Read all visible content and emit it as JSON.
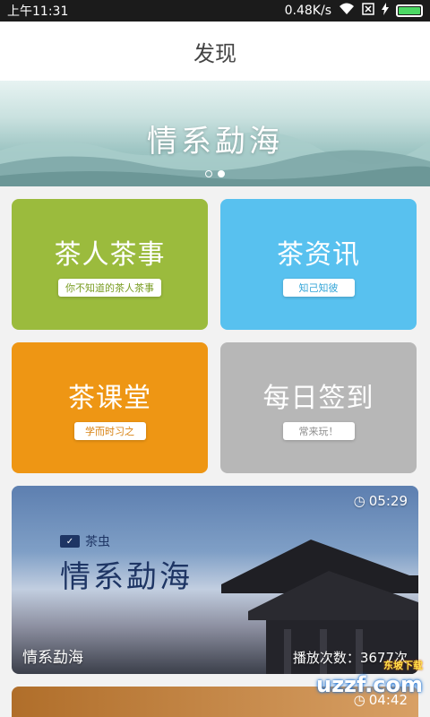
{
  "status": {
    "time": "上午11:31",
    "speed": "0.48K/s"
  },
  "appbar": {
    "title": "发现"
  },
  "banner": {
    "title": "情系勐海"
  },
  "tiles": [
    {
      "title": "茶人茶事",
      "tag": "你不知道的茶人茶事"
    },
    {
      "title": "茶资讯",
      "tag": "知己知彼"
    },
    {
      "title": "茶课堂",
      "tag": "学而时习之"
    },
    {
      "title": "每日签到",
      "tag": "常来玩！"
    }
  ],
  "video": {
    "brand": "茶虫",
    "title": "情系勐海",
    "duration": "05:29",
    "caption": "情系勐海",
    "plays": "播放次数：3677次"
  },
  "video2": {
    "duration": "04:42"
  },
  "watermark": {
    "text": "uzzf.com",
    "sub": "东坡下载"
  },
  "colors": {
    "green": "#9bbb3d",
    "blue": "#58c1ef",
    "orange": "#ee9614",
    "gray": "#b7b7b7"
  }
}
